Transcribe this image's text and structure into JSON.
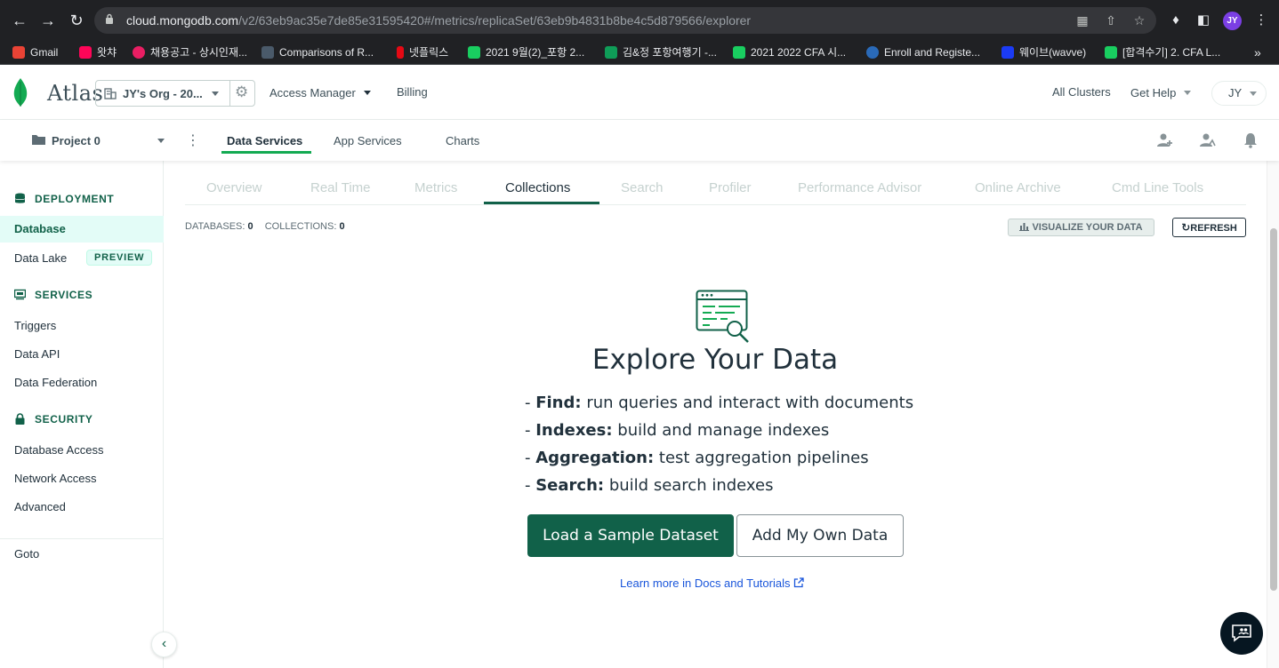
{
  "browser": {
    "url_host": "cloud.mongodb.com",
    "url_path": "/v2/63eb9ac35e7de85e31595420#/metrics/replicaSet/63eb9b4831b8be4c5d879566/explorer",
    "profile_initials": "JY",
    "bookmarks": [
      {
        "label": "Gmail",
        "color": "#ea4335"
      },
      {
        "label": "왓챠",
        "color": "#ff0558"
      },
      {
        "label": "채용공고 - 상시인재...",
        "color": "#e91e63"
      },
      {
        "label": "Comparisons of R...",
        "color": "#4a5a6a"
      },
      {
        "label": "넷플릭스",
        "color": "#e50914"
      },
      {
        "label": "2021 9월(2)_포항 2...",
        "color": "#19ce60"
      },
      {
        "label": "김&정 포항여행기 -...",
        "color": "#0f9d58"
      },
      {
        "label": "2021 2022 CFA 시...",
        "color": "#19ce60"
      },
      {
        "label": "Enroll and Registe...",
        "color": "#2a6ab8"
      },
      {
        "label": "웨이브(wavve)",
        "color": "#1b3bf5"
      },
      {
        "label": "[합격수기] 2. CFA L...",
        "color": "#19ce60"
      }
    ]
  },
  "header": {
    "logo_text": "Atlas",
    "org_name": "JY's Org - 20...",
    "access_manager": "Access Manager",
    "billing": "Billing",
    "all_clusters": "All Clusters",
    "get_help": "Get Help",
    "user_initials": "JY"
  },
  "project_bar": {
    "project_name": "Project 0",
    "tabs": [
      "Data Services",
      "App Services",
      "Charts"
    ]
  },
  "sidebar": {
    "sections": {
      "deployment": "DEPLOYMENT",
      "services": "SERVICES",
      "security": "SECURITY"
    },
    "items": {
      "database": "Database",
      "data_lake": "Data Lake",
      "preview": "PREVIEW",
      "triggers": "Triggers",
      "data_api": "Data API",
      "data_federation": "Data Federation",
      "database_access": "Database Access",
      "network_access": "Network Access",
      "advanced": "Advanced",
      "goto": "Goto"
    }
  },
  "main": {
    "tabs": [
      "Overview",
      "Real Time",
      "Metrics",
      "Collections",
      "Search",
      "Profiler",
      "Performance Advisor",
      "Online Archive",
      "Cmd Line Tools"
    ],
    "active_tab": "Collections",
    "databases_label": "DATABASES:",
    "databases_count": "0",
    "collections_label": "COLLECTIONS:",
    "collections_count": "0",
    "visualize_label": "VISUALIZE YOUR DATA",
    "refresh_label": "REFRESH",
    "explore_title": "Explore Your Data",
    "features": [
      {
        "key": "Find:",
        "text": " run queries and interact with documents"
      },
      {
        "key": "Indexes:",
        "text": " build and manage indexes"
      },
      {
        "key": "Aggregation:",
        "text": " test aggregation pipelines"
      },
      {
        "key": "Search:",
        "text": " build search indexes"
      }
    ],
    "load_sample": "Load a Sample Dataset",
    "add_own": "Add My Own Data",
    "learn_more": "Learn more in Docs and Tutorials"
  },
  "colors": {
    "brand_green": "#116149",
    "accent_green": "#13aa52",
    "link_blue": "#1a56db"
  }
}
